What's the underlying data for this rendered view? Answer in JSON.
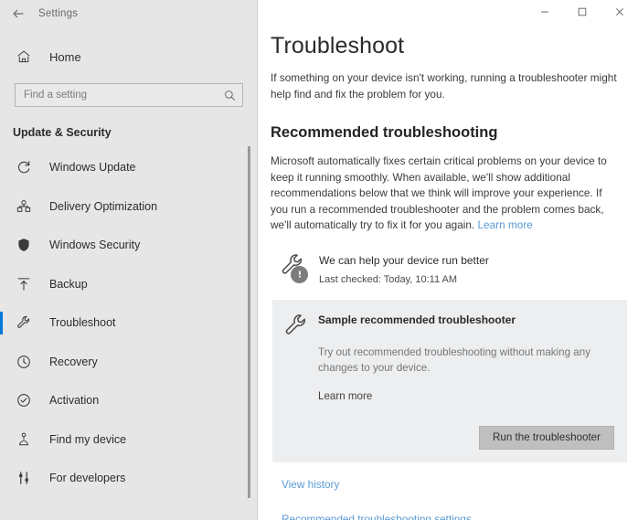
{
  "window": {
    "app_title": "Settings",
    "back_icon": "back-arrow-icon",
    "controls": {
      "minimize": "minimize-icon",
      "maximize": "maximize-icon",
      "close": "close-icon"
    }
  },
  "sidebar": {
    "home_label": "Home",
    "home_icon": "home-icon",
    "search": {
      "placeholder": "Find a setting",
      "value": "",
      "icon": "search-icon"
    },
    "section_title": "Update & Security",
    "items": [
      {
        "label": "Windows Update",
        "icon": "refresh-icon",
        "selected": false
      },
      {
        "label": "Delivery Optimization",
        "icon": "delivery-icon",
        "selected": false
      },
      {
        "label": "Windows Security",
        "icon": "shield-icon",
        "selected": false
      },
      {
        "label": "Backup",
        "icon": "backup-upload-icon",
        "selected": false
      },
      {
        "label": "Troubleshoot",
        "icon": "wrench-icon",
        "selected": true
      },
      {
        "label": "Recovery",
        "icon": "history-clock-icon",
        "selected": false
      },
      {
        "label": "Activation",
        "icon": "check-circle-icon",
        "selected": false
      },
      {
        "label": "Find my device",
        "icon": "locate-device-icon",
        "selected": false
      },
      {
        "label": "For developers",
        "icon": "developer-tools-icon",
        "selected": false
      }
    ]
  },
  "main": {
    "page_title": "Troubleshoot",
    "intro": "If something on your device isn't working, running a troubleshooter might help find and fix the problem for you.",
    "section_heading": "Recommended troubleshooting",
    "body_text": "Microsoft automatically fixes certain critical problems on your device to keep it running smoothly. When available, we'll show additional recommendations below that we think will improve your experience. If you run a recommended troubleshooter and the problem comes back, we'll automatically try to fix it for you again. ",
    "body_link": "Learn more",
    "status": {
      "icon": "wrench-icon",
      "badge_icon": "exclamation-icon",
      "title": "We can help your device run better",
      "subtitle": "Last checked: Today, 10:11 AM"
    },
    "card": {
      "icon": "wrench-icon",
      "title": "Sample recommended troubleshooter",
      "description": "Try out recommended troubleshooting without making any changes to your device.",
      "learn_more": "Learn more",
      "run_button": "Run the troubleshooter"
    },
    "footer_links": [
      {
        "label": "View history"
      },
      {
        "label": "Recommended troubleshooting settings"
      }
    ]
  },
  "colors": {
    "accent": "#0078d7",
    "link": "#5a9bd5",
    "sidebar_bg": "#e6e6e6",
    "card_bg": "#eceef0",
    "button_bg": "#bfbfbf"
  }
}
